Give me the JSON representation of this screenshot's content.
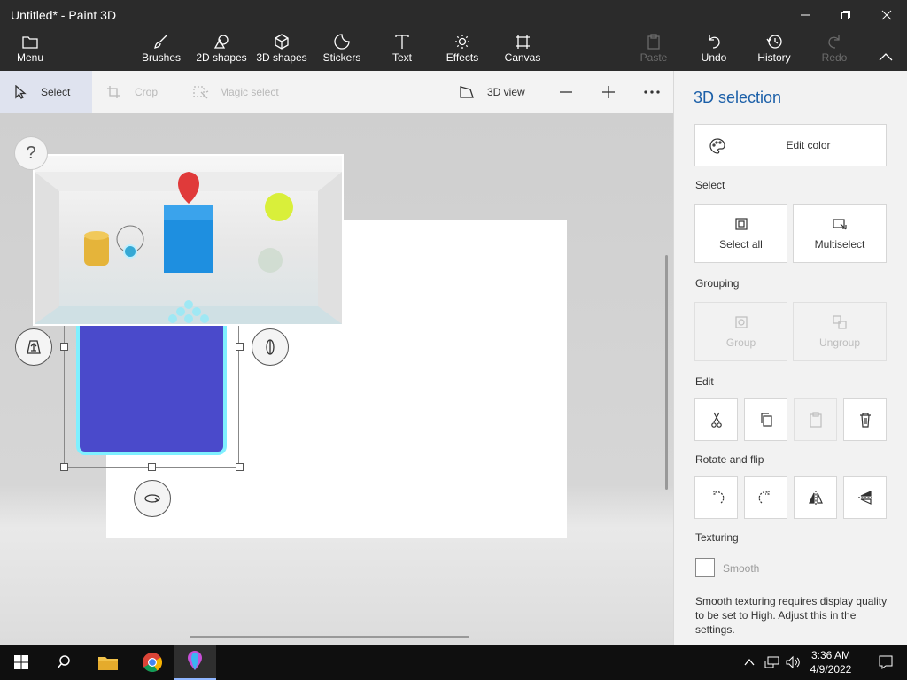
{
  "window": {
    "title": "Untitled* - Paint 3D"
  },
  "ribbon": {
    "menu": "Menu",
    "items": [
      "Brushes",
      "2D shapes",
      "3D shapes",
      "Stickers",
      "Text",
      "Effects",
      "Canvas"
    ],
    "paste": "Paste",
    "undo": "Undo",
    "history": "History",
    "redo": "Redo"
  },
  "toolbar": {
    "select": "Select",
    "crop": "Crop",
    "magic_select": "Magic select",
    "view3d": "3D view"
  },
  "canvas": {
    "help": "?"
  },
  "panel": {
    "title": "3D selection",
    "edit_color": "Edit color",
    "select_heading": "Select",
    "select_all": "Select all",
    "multiselect": "Multiselect",
    "grouping_heading": "Grouping",
    "group": "Group",
    "ungroup": "Ungroup",
    "edit_heading": "Edit",
    "rotate_heading": "Rotate and flip",
    "texturing_heading": "Texturing",
    "smooth": "Smooth",
    "smooth_checked": false,
    "note": "Smooth texturing requires display quality to be set to High. Adjust this in the settings."
  },
  "taskbar": {
    "time": "3:36 AM",
    "date": "4/9/2022"
  },
  "colors": {
    "accent": "#1b5fa8",
    "object_blue": "#4a4acb",
    "highlight": "#7ff0ff"
  }
}
